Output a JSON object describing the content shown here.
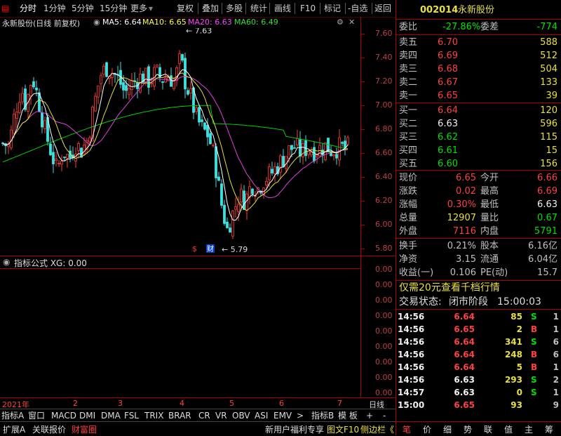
{
  "toolbar": {
    "items": [
      "分时",
      "1分钟",
      "5分钟",
      "15分钟",
      "更多",
      "复权",
      "叠加",
      "多股",
      "统计",
      "画线",
      "F10",
      "标记",
      "-自选",
      "返回"
    ]
  },
  "chart_header": {
    "name": "永新股份(日线 前复权)",
    "ma5": "MA5: 6.64",
    "ma10": "MA10: 6.65",
    "ma20": "MA20: 6.63",
    "ma60": "MA60: 6.49"
  },
  "chart_data": {
    "type": "candlestick",
    "ylim": [
      5.75,
      7.65
    ],
    "y_ticks": [
      "7.60",
      "7.40",
      "7.20",
      "7.00",
      "6.80",
      "6.60",
      "6.40",
      "6.20",
      "6.00",
      "5.80"
    ],
    "high_marker": "7.63",
    "low_marker": "5.79",
    "event_markers": [
      "$",
      "财"
    ],
    "x_labels": [
      "2021年",
      "2",
      "3",
      "4",
      "5",
      "6",
      "7",
      "日线"
    ],
    "series": [
      {
        "name": "MA5",
        "color": "#ffffff"
      },
      {
        "name": "MA10",
        "color": "#ffff00"
      },
      {
        "name": "MA20",
        "color": "#ff40ff"
      },
      {
        "name": "MA60",
        "color": "#00dd00"
      }
    ]
  },
  "indicator": {
    "label": "指标公式 XG: 0.00",
    "axis_values": [
      "0.00",
      "0.00",
      "0.00",
      "0.00",
      "0.00",
      "0.00",
      "0.00",
      "0.00",
      "0.00"
    ]
  },
  "tabs_row1": [
    "指标A",
    "窗口",
    "MACD",
    "DMI",
    "DMA",
    "FSL",
    "TRIX",
    "BRAR",
    "CR",
    "VR",
    "OBV",
    "ASI",
    "EMV",
    ">",
    "指标B",
    "模 板",
    "+",
    "-"
  ],
  "tabs_row2": {
    "left": [
      "扩展A",
      "关联报价",
      "财富圈"
    ],
    "right": [
      "新用户福利专享",
      "图文F10",
      "侧边栏《"
    ]
  },
  "quote": {
    "code": "002014",
    "name": "永新股份",
    "weibi_label": "委比",
    "weibi": "-27.86%",
    "weicha_label": "委差",
    "weicha": "-774",
    "asks": [
      {
        "label": "卖五",
        "price": "6.70",
        "vol": "588"
      },
      {
        "label": "卖四",
        "price": "6.69",
        "vol": "512"
      },
      {
        "label": "卖三",
        "price": "6.68",
        "vol": "504"
      },
      {
        "label": "卖二",
        "price": "6.67",
        "vol": "133"
      },
      {
        "label": "卖一",
        "price": "6.65",
        "vol": "39"
      }
    ],
    "bids": [
      {
        "label": "买一",
        "price": "6.64",
        "vol": "120"
      },
      {
        "label": "买二",
        "price": "6.63",
        "vol": "596"
      },
      {
        "label": "买三",
        "price": "6.62",
        "vol": "115"
      },
      {
        "label": "买四",
        "price": "6.61",
        "vol": "15"
      },
      {
        "label": "买五",
        "price": "6.60",
        "vol": "156"
      }
    ],
    "stats": [
      {
        "l1": "现价",
        "v1": "6.65",
        "l2": "今开",
        "v2": "6.66"
      },
      {
        "l1": "涨跌",
        "v1": "0.02",
        "l2": "最高",
        "v2": "6.69"
      },
      {
        "l1": "涨幅",
        "v1": "0.30%",
        "l2": "最低",
        "v2": "6.63"
      },
      {
        "l1": "总量",
        "v1": "12907",
        "l2": "量比",
        "v2": "0.67"
      },
      {
        "l1": "外盘",
        "v1": "7116",
        "l2": "内盘",
        "v2": "5791"
      }
    ],
    "stats2": [
      {
        "l1": "换手",
        "v1": "0.21%",
        "l2": "股本",
        "v2": "6.16亿"
      },
      {
        "l1": "净资",
        "v1": "3.15",
        "l2": "流通",
        "v2": "6.04亿"
      },
      {
        "l1": "收益(一)",
        "v1": "0.106",
        "l2": "PE(动)",
        "v2": "15.7"
      }
    ],
    "promo": "仅需20元查看千档行情",
    "status_label": "交易状态:",
    "status_value": "闭市阶段",
    "status_time": "15:00:03",
    "ticks": [
      {
        "t": "14:56",
        "p": "6.64",
        "v": "85",
        "bs": "S",
        "n": "1"
      },
      {
        "t": "14:56",
        "p": "6.65",
        "v": "2",
        "bs": "B",
        "n": "1"
      },
      {
        "t": "14:56",
        "p": "6.64",
        "v": "341",
        "bs": "S",
        "n": "6"
      },
      {
        "t": "14:56",
        "p": "6.64",
        "v": "248",
        "bs": "B",
        "n": "6"
      },
      {
        "t": "14:56",
        "p": "6.64",
        "v": "5",
        "bs": "B",
        "n": "1"
      },
      {
        "t": "14:56",
        "p": "6.63",
        "v": "293",
        "bs": "S",
        "n": "2"
      },
      {
        "t": "14:57",
        "p": "6.63",
        "v": "0",
        "bs": "S",
        "n": "1"
      },
      {
        "t": "15:00",
        "p": "6.65",
        "v": "93",
        "bs": "",
        "n": "9"
      }
    ],
    "bottom_tabs": [
      "笔",
      "价",
      "细",
      "势",
      "联",
      "值",
      "主",
      "筹"
    ]
  }
}
